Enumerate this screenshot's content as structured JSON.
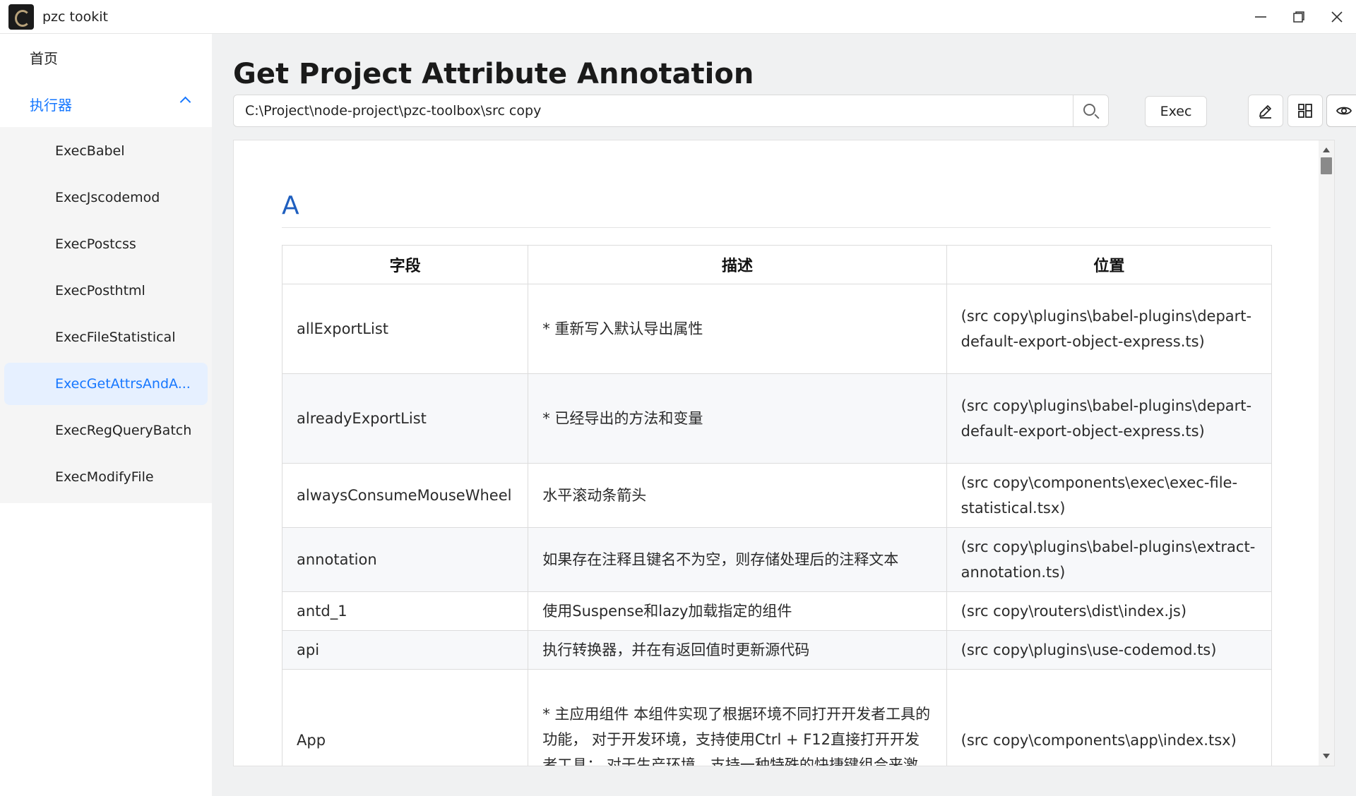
{
  "window": {
    "title": "pzc tookit",
    "controls": [
      "minimize-icon",
      "restore-icon",
      "close-icon"
    ]
  },
  "sidebar": {
    "home_label": "首页",
    "group_label": "执行器",
    "items": [
      {
        "label": "ExecBabel",
        "active": false
      },
      {
        "label": "ExecJscodemod",
        "active": false
      },
      {
        "label": "ExecPostcss",
        "active": false
      },
      {
        "label": "ExecPosthtml",
        "active": false
      },
      {
        "label": "ExecFileStatistical",
        "active": false
      },
      {
        "label": "ExecGetAttrsAndA...",
        "active": true
      },
      {
        "label": "ExecRegQueryBatch",
        "active": false
      },
      {
        "label": "ExecModifyFile",
        "active": false
      }
    ]
  },
  "main": {
    "title": "Get Project Attribute Annotation",
    "path_value": "C:\\Project\\node-project\\pzc-toolbox\\src copy",
    "exec_label": "Exec",
    "toolbar_icons": [
      "edit-icon",
      "layout-icon",
      "eye-icon"
    ]
  },
  "content": {
    "section_letter": "A",
    "headers": [
      "字段",
      "描述",
      "位置"
    ],
    "rows": [
      {
        "field": "allExportList",
        "desc": "* 重新写入默认导出属性",
        "loc": "(src copy\\plugins\\babel-plugins\\depart-default-export-object-express.ts)"
      },
      {
        "field": "alreadyExportList",
        "desc": "* 已经导出的方法和变量",
        "loc": "(src copy\\plugins\\babel-plugins\\depart-default-export-object-express.ts)"
      },
      {
        "field": "alwaysConsumeMouseWheel",
        "desc": "水平滚动条箭头",
        "loc": "(src copy\\components\\exec\\exec-file-statistical.tsx)"
      },
      {
        "field": "annotation",
        "desc": "如果存在注释且键名不为空，则存储处理后的注释文本",
        "loc": "(src copy\\plugins\\babel-plugins\\extract-annotation.ts)"
      },
      {
        "field": "antd_1",
        "desc": "使用Suspense和lazy加载指定的组件",
        "loc": "(src copy\\routers\\dist\\index.js)"
      },
      {
        "field": "api",
        "desc": "执行转换器，并在有返回值时更新源代码",
        "loc": "(src copy\\plugins\\use-codemod.ts)"
      },
      {
        "field": "App",
        "desc": "* 主应用组件 本组件实现了根据环境不同打开开发者工具的功能， 对于开发环境，支持使用Ctrl + F12直接打开开发者工具； 对于生产环境，支持一种特殊的快捷键组合来激活一个输入框，并通过输",
        "loc": "(src copy\\components\\app\\index.tsx)"
      }
    ]
  },
  "colors": {
    "accent": "#1677ff",
    "section_heading": "#1f5fbf",
    "active_item_bg": "#e6f0ff"
  }
}
